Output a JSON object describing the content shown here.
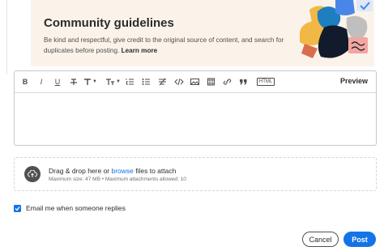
{
  "guidelines": {
    "title": "Community guidelines",
    "body": "Be kind and respectful, give credit to the original source of content, and search for duplicates before posting. ",
    "learn_more": "Learn more"
  },
  "editor": {
    "toolbar": {
      "bold": "B",
      "italic": "I",
      "underline": "U",
      "html_label": "HTML",
      "preview": "Preview"
    }
  },
  "attach": {
    "drag_text": "Drag & drop here or ",
    "browse": "browse",
    "after_browse": " files to attach",
    "limits": "Maximum size: 47 MB • Maximum attachments allowed: 10"
  },
  "email": {
    "label": "Email me when someone replies",
    "checked": true
  },
  "actions": {
    "cancel": "Cancel",
    "post": "Post"
  },
  "colors": {
    "accent": "#1473e6",
    "banner_bg": "#fbf3ea"
  }
}
